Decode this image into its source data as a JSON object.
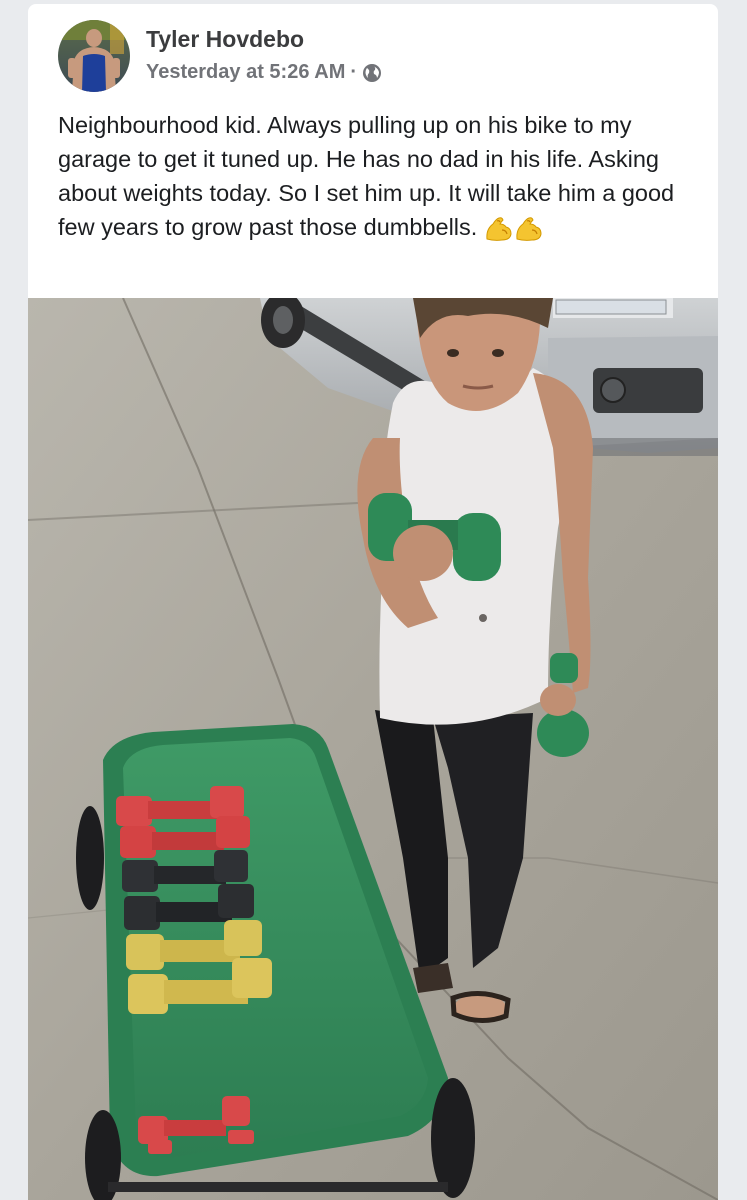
{
  "post": {
    "author": "Tyler Hovdebo",
    "timestamp": "Yesterday at 5:26 AM",
    "separator": "·",
    "audience_icon": "globe-icon",
    "text": "Neighbourhood kid. Always pulling up on his bike to my garage to get it tuned up. He has no dad in his life. Asking about weights today. So I set him up. It will take him a good few years to grow past those dumbbells.",
    "emoji": [
      "flexed-biceps-emoji",
      "flexed-biceps-emoji"
    ],
    "photo_icon": "photo-boy-with-dumbbells"
  },
  "colors": {
    "author": "#3b3c3e",
    "meta": "#717378",
    "body_text": "#1c1e21",
    "wagon": "#2f8b5a",
    "dumbbell_held": "#2e8a57"
  }
}
